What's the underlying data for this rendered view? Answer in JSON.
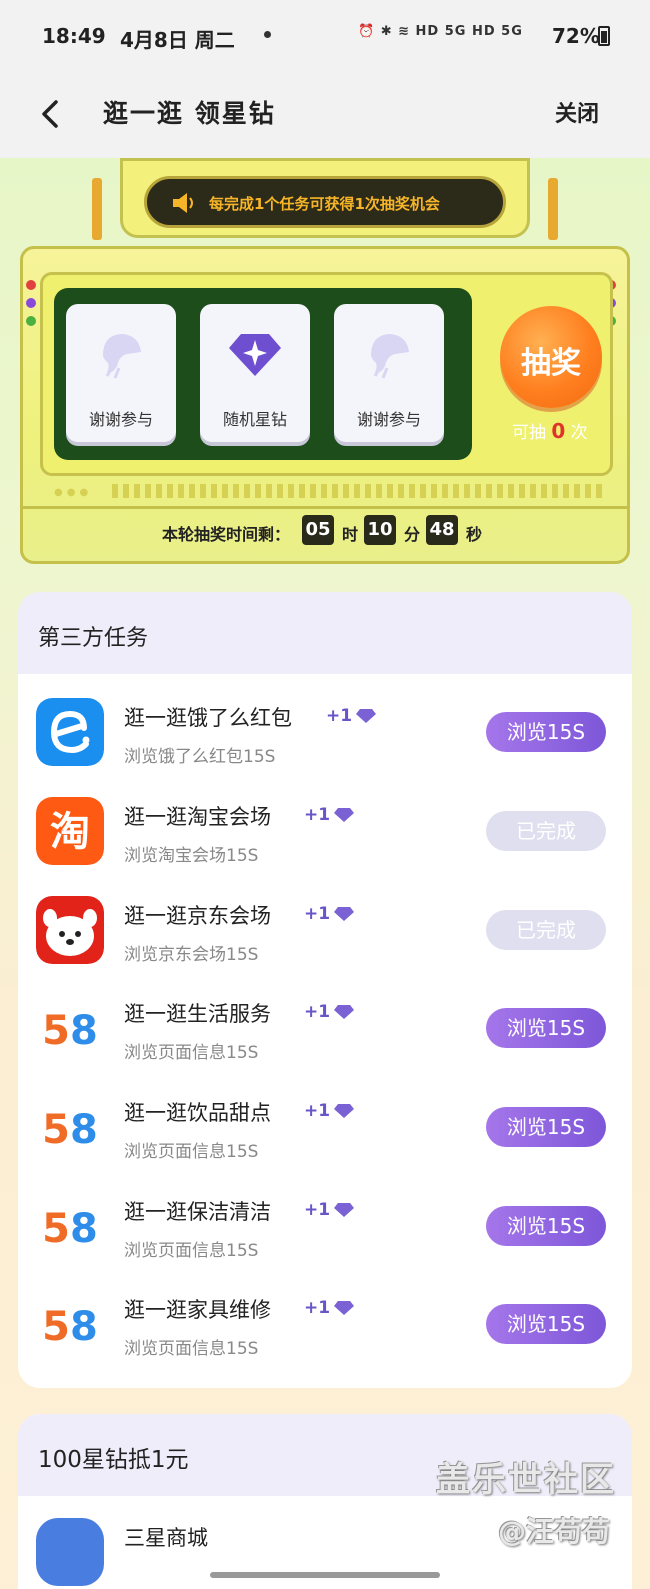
{
  "status_bar": {
    "time": "18:49",
    "date": "4月8日 周二",
    "icons": "⏰ ✱ ≋ HD 5G HD 5G",
    "battery": "72%"
  },
  "header": {
    "title": "逛一逛 领星钻",
    "close_label": "关闭"
  },
  "lottery": {
    "banner_text": "每完成1个任务可获得1次抽奖机会",
    "prizes": [
      {
        "label": "谢谢参与",
        "icon": "sorry-icon"
      },
      {
        "label": "随机星钻",
        "icon": "star-diamond-icon"
      },
      {
        "label": "谢谢参与",
        "icon": "sorry-icon"
      }
    ],
    "draw_label": "抽奖",
    "draw_count_prefix": "可抽",
    "draw_count": "0",
    "draw_count_suffix": "次",
    "timer_label": "本轮抽奖时间剩：",
    "hours": "05",
    "hours_unit": "时",
    "minutes": "10",
    "minutes_unit": "分",
    "seconds": "48",
    "seconds_unit": "秒"
  },
  "third_party_tasks": {
    "title": "第三方任务",
    "tasks": [
      {
        "title": "逛一逛饿了么红包",
        "reward": "+1",
        "subtitle": "浏览饿了么红包15S",
        "button": "浏览15S",
        "state": "active",
        "icon": "eleme-icon"
      },
      {
        "title": "逛一逛淘宝会场",
        "reward": "+1",
        "subtitle": "浏览淘宝会场15S",
        "button": "已完成",
        "state": "done",
        "icon": "taobao-icon"
      },
      {
        "title": "逛一逛京东会场",
        "reward": "+1",
        "subtitle": "浏览京东会场15S",
        "button": "已完成",
        "state": "done",
        "icon": "jd-icon"
      },
      {
        "title": "逛一逛生活服务",
        "reward": "+1",
        "subtitle": "浏览页面信息15S",
        "button": "浏览15S",
        "state": "active",
        "icon": "58-icon"
      },
      {
        "title": "逛一逛饮品甜点",
        "reward": "+1",
        "subtitle": "浏览页面信息15S",
        "button": "浏览15S",
        "state": "active",
        "icon": "58-icon"
      },
      {
        "title": "逛一逛保洁清洁",
        "reward": "+1",
        "subtitle": "浏览页面信息15S",
        "button": "浏览15S",
        "state": "active",
        "icon": "58-icon"
      },
      {
        "title": "逛一逛家具维修",
        "reward": "+1",
        "subtitle": "浏览页面信息15S",
        "button": "浏览15S",
        "state": "active",
        "icon": "58-icon"
      }
    ]
  },
  "coupon_section": {
    "title": "100星钻抵1元",
    "first_task": "三星商城"
  },
  "watermark": {
    "line1": "盖乐世社区",
    "line2": "@汪苟苟"
  },
  "colors": {
    "accent_purple": "#7d57d9",
    "draw_orange": "#ff7f1f",
    "panel_green": "#1e4d1c",
    "banner_text": "#f6b528"
  }
}
